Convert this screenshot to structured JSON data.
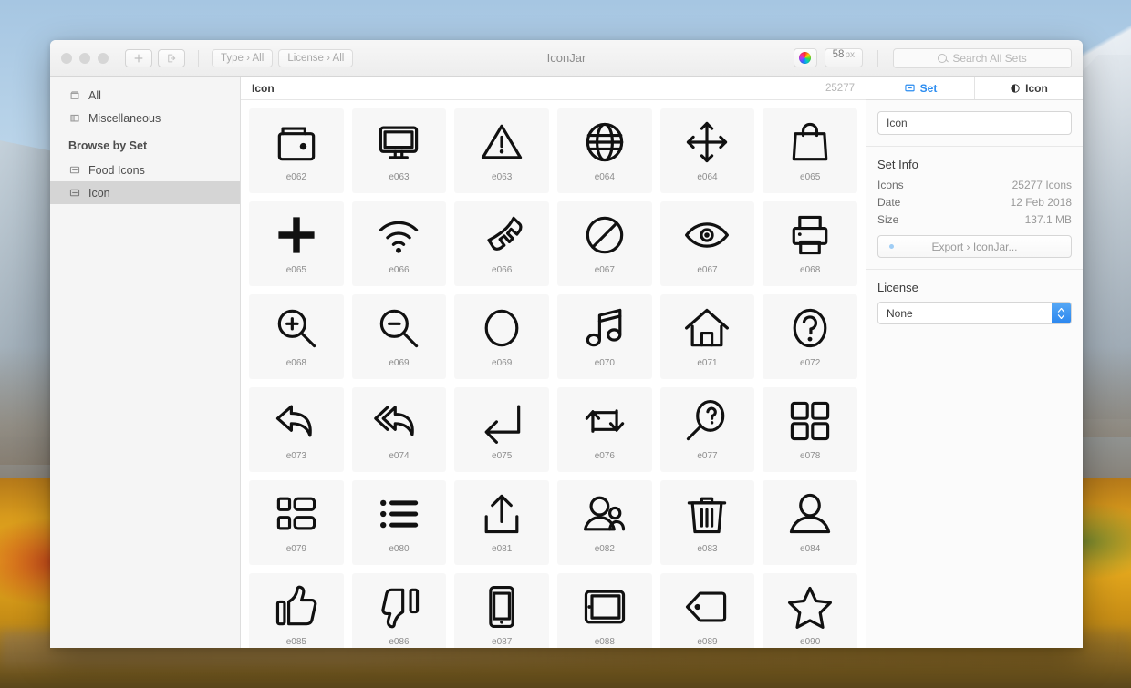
{
  "window": {
    "title": "IconJar"
  },
  "toolbar": {
    "add_label": "+",
    "export_label": "export-icon",
    "type_filter": "Type › All",
    "license_filter": "License › All",
    "color_wheel": "color-wheel-icon",
    "size_value": "58",
    "size_unit": "px",
    "search_placeholder": "Search All Sets"
  },
  "sidebar": {
    "items": [
      {
        "label": "All",
        "icon": "box-icon",
        "selected": false
      },
      {
        "label": "Miscellaneous",
        "icon": "folder-icon",
        "selected": false
      }
    ],
    "section_header": "Browse by Set",
    "sets": [
      {
        "label": "Food Icons",
        "icon": "set-icon",
        "selected": false
      },
      {
        "label": "Icon",
        "icon": "set-icon",
        "selected": true
      }
    ]
  },
  "main": {
    "header_title": "Icon",
    "count": "25277",
    "icons": [
      {
        "label": "e062",
        "name": "wallet-icon"
      },
      {
        "label": "e063",
        "name": "monitor-icon"
      },
      {
        "label": "e063",
        "name": "warning-triangle-icon"
      },
      {
        "label": "e064",
        "name": "globe-icon"
      },
      {
        "label": "e064",
        "name": "move-arrows-icon"
      },
      {
        "label": "e065",
        "name": "shopping-bag-icon"
      },
      {
        "label": "e065",
        "name": "plus-icon"
      },
      {
        "label": "e066",
        "name": "wifi-icon"
      },
      {
        "label": "e066",
        "name": "phone-handset-icon"
      },
      {
        "label": "e067",
        "name": "no-entry-icon"
      },
      {
        "label": "e067",
        "name": "eye-icon"
      },
      {
        "label": "e068",
        "name": "printer-icon"
      },
      {
        "label": "e068",
        "name": "zoom-in-icon"
      },
      {
        "label": "e069",
        "name": "zoom-out-icon"
      },
      {
        "label": "e069",
        "name": "circle-icon"
      },
      {
        "label": "e070",
        "name": "music-note-icon"
      },
      {
        "label": "e071",
        "name": "home-icon"
      },
      {
        "label": "e072",
        "name": "question-mark-icon"
      },
      {
        "label": "e073",
        "name": "reply-icon"
      },
      {
        "label": "e074",
        "name": "reply-all-icon"
      },
      {
        "label": "e075",
        "name": "return-arrow-icon"
      },
      {
        "label": "e076",
        "name": "repeat-icon"
      },
      {
        "label": "e077",
        "name": "search-question-icon"
      },
      {
        "label": "e078",
        "name": "grid-four-icon"
      },
      {
        "label": "e079",
        "name": "list-grid-icon"
      },
      {
        "label": "e080",
        "name": "bullet-list-icon"
      },
      {
        "label": "e081",
        "name": "upload-icon"
      },
      {
        "label": "e082",
        "name": "users-icon"
      },
      {
        "label": "e083",
        "name": "trash-icon"
      },
      {
        "label": "e084",
        "name": "user-icon"
      },
      {
        "label": "e085",
        "name": "thumbs-up-icon"
      },
      {
        "label": "e086",
        "name": "thumbs-down-icon"
      },
      {
        "label": "e087",
        "name": "mobile-phone-icon"
      },
      {
        "label": "e088",
        "name": "tablet-icon"
      },
      {
        "label": "e089",
        "name": "tag-icon"
      },
      {
        "label": "e090",
        "name": "star-icon"
      }
    ]
  },
  "inspector": {
    "tabs": [
      {
        "label": "Set",
        "icon": "set-icon",
        "active": true
      },
      {
        "label": "Icon",
        "icon": "circle-half-icon",
        "active": false
      }
    ],
    "set_name": "Icon",
    "set_info": {
      "title": "Set Info",
      "rows": [
        {
          "key": "Icons",
          "value": "25277 Icons"
        },
        {
          "key": "Date",
          "value": "12 Feb 2018"
        },
        {
          "key": "Size",
          "value": "137.1 MB"
        }
      ],
      "export_label": "Export › IconJar..."
    },
    "license": {
      "title": "License",
      "value": "None"
    }
  },
  "colors": {
    "accent": "#2b8cf0",
    "selected_row": "#d5d5d5",
    "cell_bg": "#f7f7f7"
  }
}
